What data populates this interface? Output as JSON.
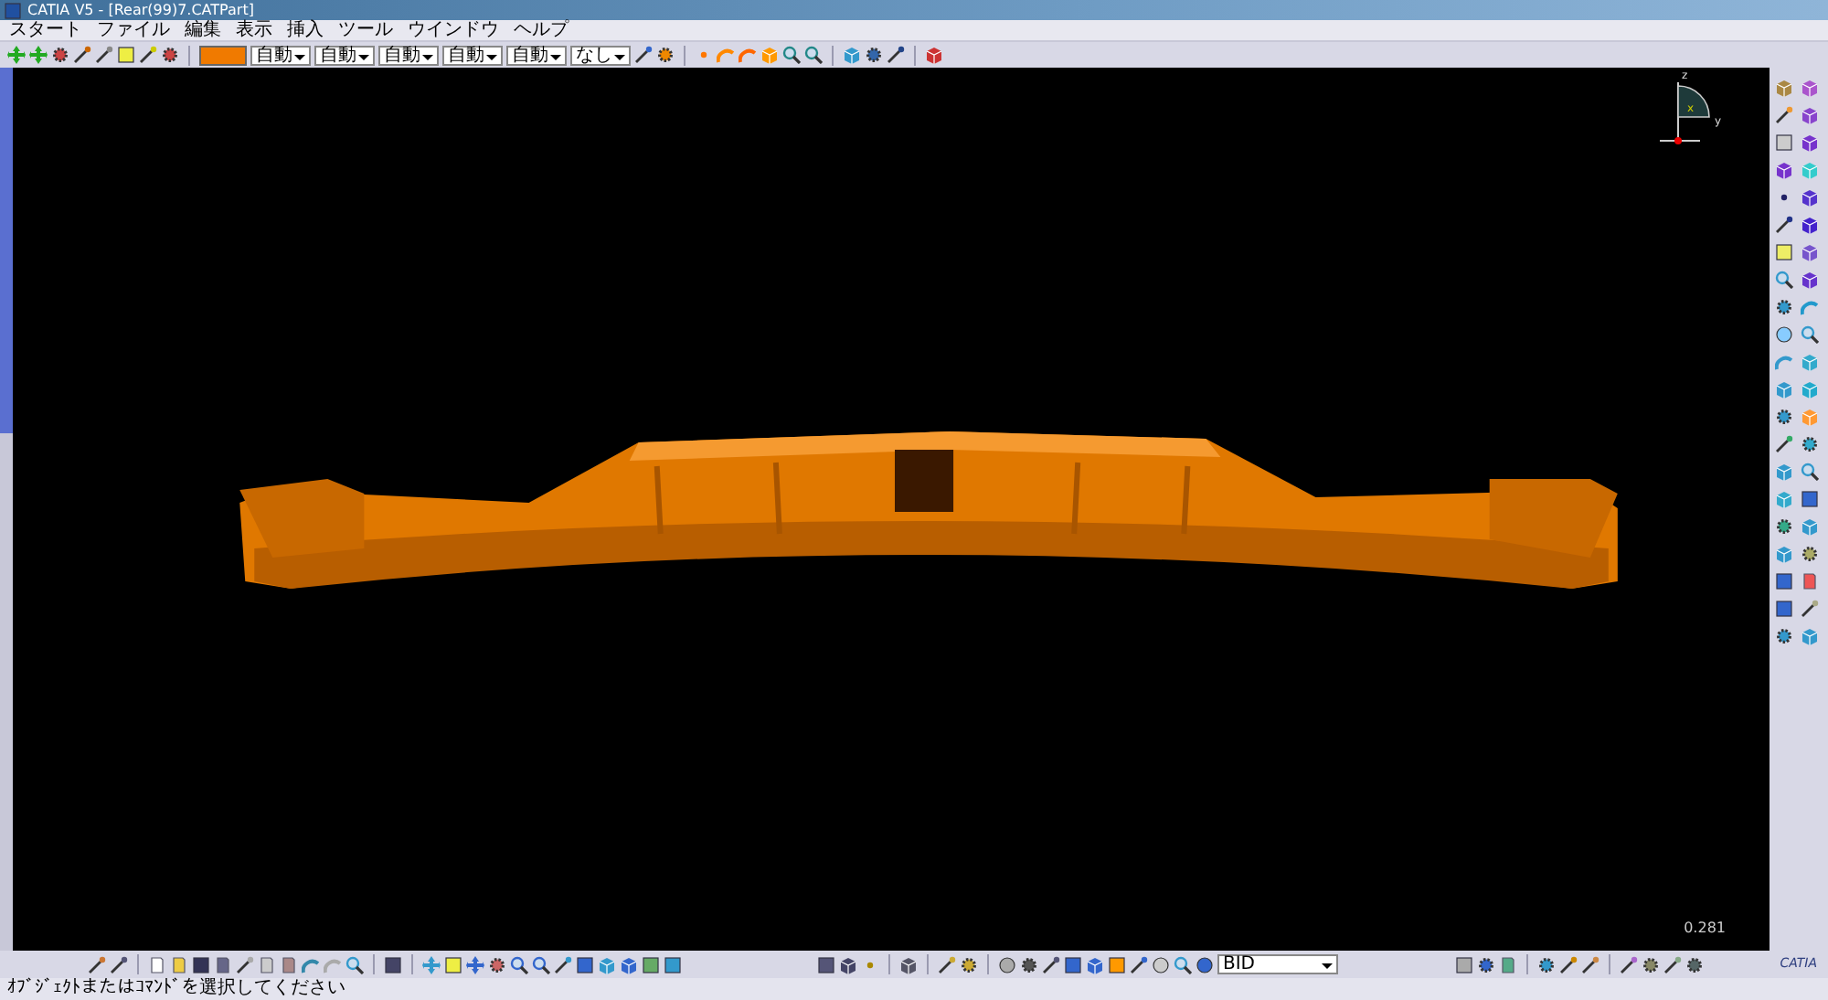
{
  "window": {
    "title": "CATIA V5 - [Rear(99)7.CATPart]"
  },
  "menu": [
    {
      "label": "スタート"
    },
    {
      "label": "ファイル"
    },
    {
      "label": "編集"
    },
    {
      "label": "表示"
    },
    {
      "label": "挿入"
    },
    {
      "label": "ツール"
    },
    {
      "label": "ウインドウ"
    },
    {
      "label": "ヘルプ"
    }
  ],
  "toolbar": {
    "dropdowns": [
      {
        "value": "自動"
      },
      {
        "value": "自動"
      },
      {
        "value": "自動"
      },
      {
        "value": "自動"
      },
      {
        "value": "自動"
      },
      {
        "value": "なし"
      }
    ]
  },
  "viewport": {
    "compass": {
      "labels": [
        "z",
        "x",
        "y"
      ]
    },
    "scale": "0.281"
  },
  "bottom_toolbar": {
    "dropdown": {
      "value": "BID"
    }
  },
  "logo": {
    "text": "CATIA"
  },
  "status_bar": {
    "message": "ｵﾌﾞｼﾞｪｸﾄまたはｺﾏﾝﾄﾞを選択してください"
  }
}
